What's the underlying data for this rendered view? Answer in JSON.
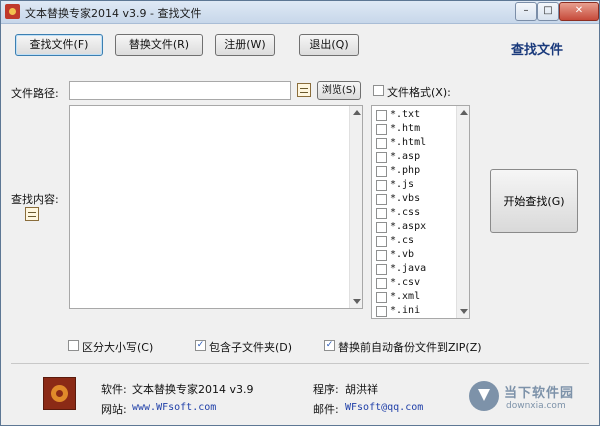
{
  "window": {
    "title": "文本替换专家2014 v3.9 - 查找文件"
  },
  "toolbar": {
    "find_label": "查找文件(F)",
    "replace_label": "替换文件(R)",
    "register_label": "注册(W)",
    "exit_label": "退出(Q)"
  },
  "page_title": "查找文件",
  "form": {
    "path_label": "文件路径:",
    "path_value": "",
    "browse_label": "浏览(S)",
    "format_label": "文件格式(X):",
    "format_checked": false,
    "content_label": "查找内容:",
    "content_value": ""
  },
  "file_formats": [
    {
      "label": "*.txt",
      "checked": false
    },
    {
      "label": "*.htm",
      "checked": false
    },
    {
      "label": "*.html",
      "checked": false
    },
    {
      "label": "*.asp",
      "checked": false
    },
    {
      "label": "*.php",
      "checked": false
    },
    {
      "label": "*.js",
      "checked": false
    },
    {
      "label": "*.vbs",
      "checked": false
    },
    {
      "label": "*.css",
      "checked": false
    },
    {
      "label": "*.aspx",
      "checked": false
    },
    {
      "label": "*.cs",
      "checked": false
    },
    {
      "label": "*.vb",
      "checked": false
    },
    {
      "label": "*.java",
      "checked": false
    },
    {
      "label": "*.csv",
      "checked": false
    },
    {
      "label": "*.xml",
      "checked": false
    },
    {
      "label": "*.ini",
      "checked": false
    }
  ],
  "start_label": "开始查找(G)",
  "options": {
    "case_label": "区分大小写(C)",
    "case_checked": false,
    "subfolder_label": "包含子文件夹(D)",
    "subfolder_checked": true,
    "backup_label": "替换前自动备份文件到ZIP(Z)",
    "backup_checked": true
  },
  "footer": {
    "software_label": "软件:",
    "software_value": "文本替换专家2014 v3.9",
    "site_label": "网站:",
    "site_value": "www.WFsoft.com",
    "author_label": "程序:",
    "author_value": "胡洪祥",
    "email_label": "邮件:",
    "email_value": "WFsoft@qq.com"
  },
  "watermark": {
    "text": "当下软件园",
    "sub": "downxia.com"
  },
  "colors": {
    "accent": "#1a3a7c",
    "link": "#1f3fa8",
    "check": "#2a5bb8"
  },
  "icons": {
    "app": "app-icon",
    "path_picker": "list-icon",
    "content_picker": "list-icon",
    "logo": "wfsoft-logo"
  }
}
